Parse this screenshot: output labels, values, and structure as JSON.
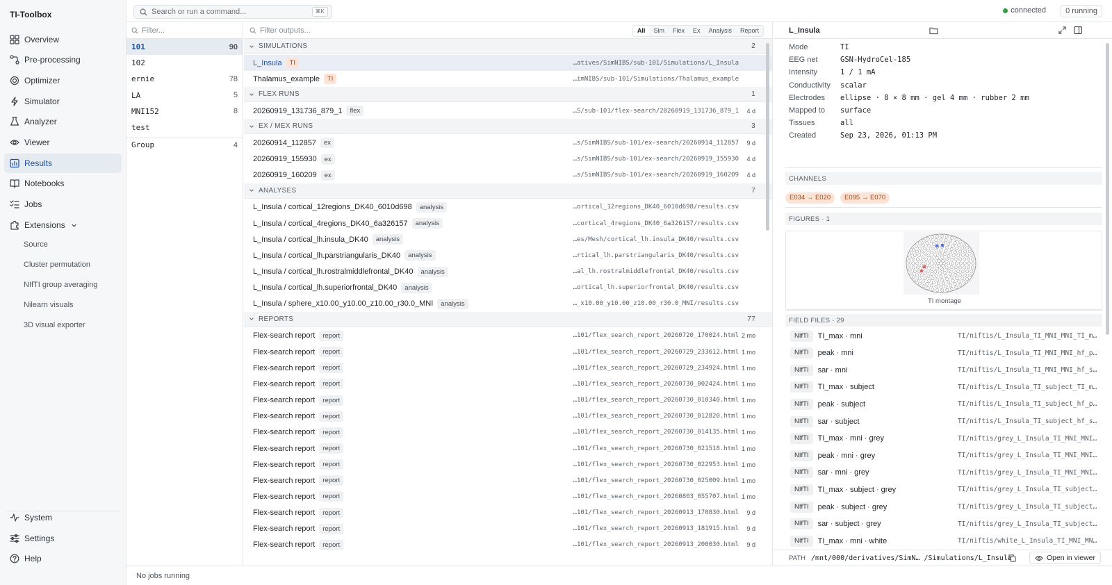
{
  "brand": "TI-Toolbox",
  "nav": [
    {
      "label": "Overview",
      "icon": "grid-icon"
    },
    {
      "label": "Pre-processing",
      "icon": "pipeline-icon"
    },
    {
      "label": "Optimizer",
      "icon": "target-icon"
    },
    {
      "label": "Simulator",
      "icon": "bolt-icon"
    },
    {
      "label": "Analyzer",
      "icon": "flask-icon"
    },
    {
      "label": "Viewer",
      "icon": "eye-icon"
    },
    {
      "label": "Results",
      "icon": "folder-chart-icon"
    },
    {
      "label": "Notebooks",
      "icon": "book-icon"
    },
    {
      "label": "Jobs",
      "icon": "list-check-icon"
    },
    {
      "label": "Extensions",
      "icon": "puzzle-icon"
    }
  ],
  "extensions": [
    "Source",
    "Cluster permutation",
    "NIfTI group averaging",
    "Nilearn visuals",
    "3D visual exporter"
  ],
  "bottom_nav": [
    {
      "label": "System",
      "icon": "activity-icon"
    },
    {
      "label": "Settings",
      "icon": "sliders-icon"
    },
    {
      "label": "Help",
      "icon": "help-icon"
    }
  ],
  "topbar": {
    "search_placeholder": "Search or run a command...",
    "shortcut": "⌘K",
    "status": "connected",
    "running": "0 running"
  },
  "subjects": {
    "filter_placeholder": "Filter...",
    "items": [
      {
        "name": "101",
        "count": "90"
      },
      {
        "name": "102",
        "count": ""
      },
      {
        "name": "ernie",
        "count": "78"
      },
      {
        "name": "LA",
        "count": "5"
      },
      {
        "name": "MNI152",
        "count": "8"
      },
      {
        "name": "test",
        "count": ""
      }
    ],
    "group": {
      "name": "Group",
      "count": "4"
    }
  },
  "outputs": {
    "filter_placeholder": "Filter outputs...",
    "tabs": [
      "All",
      "Sim",
      "Flex",
      "Ex",
      "Analysis",
      "Report"
    ],
    "sections": [
      {
        "title": "SIMULATIONS",
        "count": "2",
        "rows": [
          {
            "name": "L_Insula",
            "tag": "TI",
            "path": "…atives/SimNIBS/sub-101/Simulations/L_Insula",
            "age": ""
          },
          {
            "name": "Thalamus_example",
            "tag": "TI",
            "path": "…imNIBS/sub-101/Simulations/Thalamus_example",
            "age": ""
          }
        ]
      },
      {
        "title": "FLEX RUNS",
        "count": "1",
        "rows": [
          {
            "name": "20260919_131736_879_1",
            "tag": "flex",
            "path": "…S/sub-101/flex-search/20260919_131736_879_1",
            "age": "4 d"
          }
        ]
      },
      {
        "title": "EX / MEX RUNS",
        "count": "3",
        "rows": [
          {
            "name": "20260914_112857",
            "tag": "ex",
            "path": "…s/SimNIBS/sub-101/ex-search/20260914_112857",
            "age": "9 d"
          },
          {
            "name": "20260919_155930",
            "tag": "ex",
            "path": "…s/SimNIBS/sub-101/ex-search/20260919_155930",
            "age": "4 d"
          },
          {
            "name": "20260919_160209",
            "tag": "ex",
            "path": "…s/SimNIBS/sub-101/ex-search/20260919_160209",
            "age": "4 d"
          }
        ]
      },
      {
        "title": "ANALYSES",
        "count": "7",
        "rows": [
          {
            "name": "L_Insula / cortical_12regions_DK40_6010d698",
            "tag": "analysis",
            "path": "…ortical_12regions_DK40_6010d698/results.csv",
            "age": ""
          },
          {
            "name": "L_Insula / cortical_4regions_DK40_6a326157",
            "tag": "analysis",
            "path": "…cortical_4regions_DK40_6a326157/results.csv",
            "age": ""
          },
          {
            "name": "L_Insula / cortical_lh.insula_DK40",
            "tag": "analysis",
            "path": "…es/Mesh/cortical_lh.insula_DK40/results.csv",
            "age": ""
          },
          {
            "name": "L_Insula / cortical_lh.parstriangularis_DK40",
            "tag": "analysis",
            "path": "…rtical_lh.parstriangularis_DK40/results.csv",
            "age": ""
          },
          {
            "name": "L_Insula / cortical_lh.rostralmiddlefrontal_DK40",
            "tag": "analysis",
            "path": "…al_lh.rostralmiddlefrontal_DK40/results.csv",
            "age": ""
          },
          {
            "name": "L_Insula / cortical_lh.superiorfrontal_DK40",
            "tag": "analysis",
            "path": "…ortical_lh.superiorfrontal_DK40/results.csv",
            "age": ""
          },
          {
            "name": "L_Insula / sphere_x10.00_y10.00_z10.00_r30.0_MNI",
            "tag": "analysis",
            "path": "…_x10.00_y10.00_z10.00_r30.0_MNI/results.csv",
            "age": ""
          }
        ]
      },
      {
        "title": "REPORTS",
        "count": "77",
        "rows": [
          {
            "name": "Flex-search report",
            "tag": "report",
            "path": "…101/flex_search_report_20260720_170024.html",
            "age": "2 mo"
          },
          {
            "name": "Flex-search report",
            "tag": "report",
            "path": "…101/flex_search_report_20260729_233612.html",
            "age": "1 mo"
          },
          {
            "name": "Flex-search report",
            "tag": "report",
            "path": "…101/flex_search_report_20260729_234924.html",
            "age": "1 mo"
          },
          {
            "name": "Flex-search report",
            "tag": "report",
            "path": "…101/flex_search_report_20260730_002424.html",
            "age": "1 mo"
          },
          {
            "name": "Flex-search report",
            "tag": "report",
            "path": "…101/flex_search_report_20260730_010340.html",
            "age": "1 mo"
          },
          {
            "name": "Flex-search report",
            "tag": "report",
            "path": "…101/flex_search_report_20260730_012820.html",
            "age": "1 mo"
          },
          {
            "name": "Flex-search report",
            "tag": "report",
            "path": "…101/flex_search_report_20260730_014135.html",
            "age": "1 mo"
          },
          {
            "name": "Flex-search report",
            "tag": "report",
            "path": "…101/flex_search_report_20260730_021518.html",
            "age": "1 mo"
          },
          {
            "name": "Flex-search report",
            "tag": "report",
            "path": "…101/flex_search_report_20260730_022953.html",
            "age": "1 mo"
          },
          {
            "name": "Flex-search report",
            "tag": "report",
            "path": "…101/flex_search_report_20260730_025009.html",
            "age": "1 mo"
          },
          {
            "name": "Flex-search report",
            "tag": "report",
            "path": "…101/flex_search_report_20260803_055707.html",
            "age": "1 mo"
          },
          {
            "name": "Flex-search report",
            "tag": "report",
            "path": "…101/flex_search_report_20260913_170830.html",
            "age": "9 d"
          },
          {
            "name": "Flex-search report",
            "tag": "report",
            "path": "…101/flex_search_report_20260913_181915.html",
            "age": "9 d"
          },
          {
            "name": "Flex-search report",
            "tag": "report",
            "path": "…101/flex_search_report_20260913_200030.html",
            "age": "9 d"
          }
        ]
      }
    ]
  },
  "detail": {
    "title": "L_Insula",
    "props": [
      {
        "key": "Mode",
        "value": "TI"
      },
      {
        "key": "EEG net",
        "value": "GSN-HydroCel-185"
      },
      {
        "key": "Intensity",
        "value": "1 / 1 mA"
      },
      {
        "key": "Conductivity",
        "value": "scalar"
      },
      {
        "key": "Electrodes",
        "value": "ellipse · 8 × 8 mm · gel 4 mm · rubber 2 mm"
      },
      {
        "key": "Mapped to",
        "value": "surface"
      },
      {
        "key": "Tissues",
        "value": "all"
      },
      {
        "key": "Created",
        "value": "Sep 23, 2026, 01:13 PM"
      }
    ],
    "channels_title": "CHANNELS",
    "channels": [
      "E034 → E020",
      "E095 → E070"
    ],
    "figures_title": "FIGURES · 1",
    "figure_caption": "TI montage",
    "field_files_title": "FIELD FILES · 29",
    "field_files": [
      {
        "badge": "NIfTI",
        "name": "TI_max · mni",
        "path": "TI/niftis/L_Insula_TI_MNI_MNI_TI_m…"
      },
      {
        "badge": "NIfTI",
        "name": "peak · mni",
        "path": "TI/niftis/L_Insula_TI_MNI_MNI_hf_p…"
      },
      {
        "badge": "NIfTI",
        "name": "sar · mni",
        "path": "TI/niftis/L_Insula_TI_MNI_MNI_hf_s…"
      },
      {
        "badge": "NIfTI",
        "name": "TI_max · subject",
        "path": "TI/niftis/L_Insula_TI_subject_TI_m…"
      },
      {
        "badge": "NIfTI",
        "name": "peak · subject",
        "path": "TI/niftis/L_Insula_TI_subject_hf_p…"
      },
      {
        "badge": "NIfTI",
        "name": "sar · subject",
        "path": "TI/niftis/L_Insula_TI_subject_hf_s…"
      },
      {
        "badge": "NIfTI",
        "name": "TI_max · mni · grey",
        "path": "TI/niftis/grey_L_Insula_TI_MNI_MNI…"
      },
      {
        "badge": "NIfTI",
        "name": "peak · mni · grey",
        "path": "TI/niftis/grey_L_Insula_TI_MNI_MNI…"
      },
      {
        "badge": "NIfTI",
        "name": "sar · mni · grey",
        "path": "TI/niftis/grey_L_Insula_TI_MNI_MNI…"
      },
      {
        "badge": "NIfTI",
        "name": "TI_max · subject · grey",
        "path": "TI/niftis/grey_L_Insula_TI_subject…"
      },
      {
        "badge": "NIfTI",
        "name": "peak · subject · grey",
        "path": "TI/niftis/grey_L_Insula_TI_subject…"
      },
      {
        "badge": "NIfTI",
        "name": "sar · subject · grey",
        "path": "TI/niftis/grey_L_Insula_TI_subject…"
      },
      {
        "badge": "NIfTI",
        "name": "TI_max · mni · white",
        "path": "TI/niftis/white_L_Insula_TI_MNI_MN…"
      }
    ],
    "path_label": "PATH",
    "path_value": "/mnt/000/derivatives/SimN… /Simulations/L_Insula",
    "open_label": "Open in viewer"
  },
  "footer": {
    "status": "No jobs running"
  },
  "colors": {
    "accent": "#1f4f99",
    "active_bg": "#e6ebf2",
    "ti_tag": "#fbe3d6",
    "connected": "#2ea043"
  }
}
